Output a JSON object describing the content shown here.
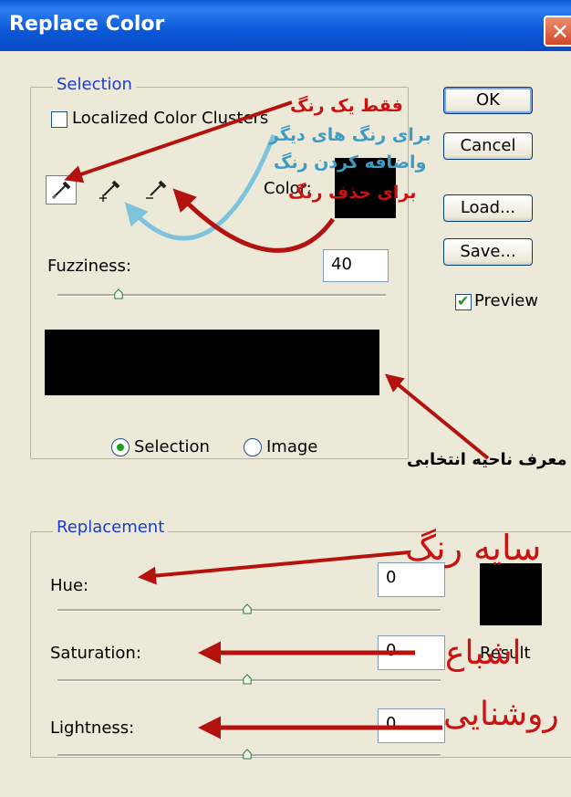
{
  "window": {
    "title": "Replace Color"
  },
  "selection": {
    "group_label": "Selection",
    "localized_label": "Localized Color Clusters",
    "color_label": "Color:",
    "fuzziness_label": "Fuzziness:",
    "fuzziness_value": "40",
    "radio_selection_label": "Selection",
    "radio_image_label": "Image",
    "selected_mode": "Selection"
  },
  "buttons": {
    "ok": "OK",
    "cancel": "Cancel",
    "load": "Load...",
    "save": "Save..."
  },
  "preview": {
    "label": "Preview",
    "checked": true
  },
  "replacement": {
    "group_label": "Replacement",
    "hue_label": "Hue:",
    "hue_value": "0",
    "saturation_label": "Saturation:",
    "saturation_value": "0",
    "lightness_label": "Lightness:",
    "lightness_value": "0",
    "result_label": "Result"
  },
  "annotations": {
    "one_color": "فقط یک رنگ",
    "add_color_1": "برای رنگ های دیگر",
    "add_color_2": "واضافه کردن رنگ",
    "remove_color": "برای حذف رنگ",
    "selection_area": "معرف ناحیه انتخابی",
    "hue": "سایه رنگ",
    "saturation": "اشباع",
    "lightness": "روشنایی"
  },
  "colors": {
    "red_text": "#cc1111",
    "blue_text": "#3d9bc4",
    "arrow_red": "#b4120e",
    "arrow_blue": "#7ec3dc"
  },
  "slider_levels": {
    "fuzziness": 0.2,
    "hue": 0.5,
    "saturation": 0.5,
    "lightness": 0.5
  }
}
